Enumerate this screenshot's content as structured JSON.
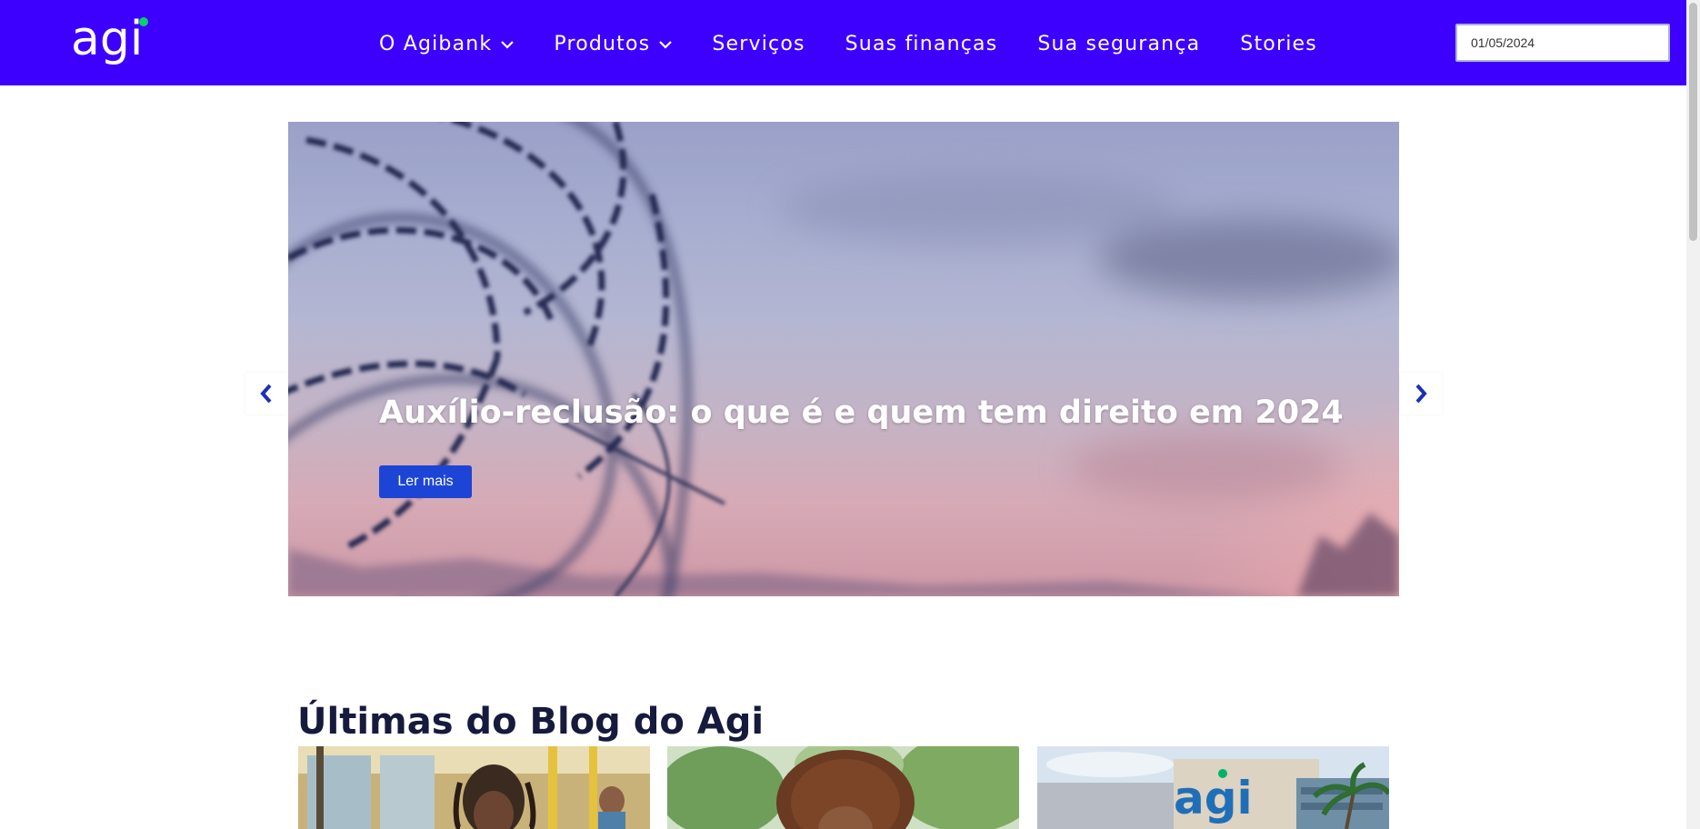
{
  "header": {
    "logo_text": "agi",
    "background": "#3d00ff",
    "nav": [
      {
        "label": "O Agibank",
        "has_dropdown": true
      },
      {
        "label": "Produtos",
        "has_dropdown": true
      },
      {
        "label": "Serviços",
        "has_dropdown": false
      },
      {
        "label": "Suas finanças",
        "has_dropdown": false
      },
      {
        "label": "Sua segurança",
        "has_dropdown": false
      },
      {
        "label": "Stories",
        "has_dropdown": false
      }
    ],
    "date_field": {
      "value": "01/05/2024"
    }
  },
  "hero": {
    "title": "Auxílio-reclusão: o que é e quem tem direito em 2024",
    "button_label": "Ler mais",
    "button_color": "#1c45d6",
    "prev_icon": "chevron-left-icon",
    "next_icon": "chevron-right-icon"
  },
  "blog": {
    "title": "Últimas do Blog do Agi",
    "cards": [
      {
        "image": "woman-on-bus-photo"
      },
      {
        "image": "curly-hair-woman-photo"
      },
      {
        "image": "agi-building-photo",
        "sign_text": "agi"
      }
    ]
  },
  "colors": {
    "brand": "#3d00ff",
    "accent_green": "#00d26a",
    "heading": "#161a3c"
  }
}
